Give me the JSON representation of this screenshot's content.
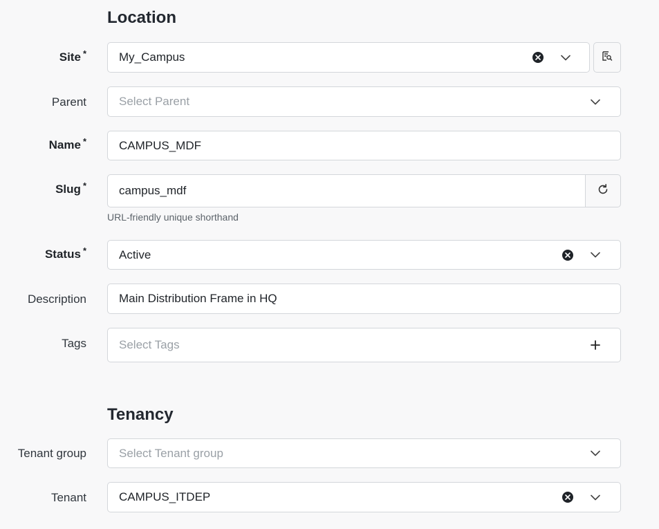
{
  "location": {
    "title": "Location",
    "site": {
      "label": "Site",
      "required_mark": "*",
      "value": "My_Campus"
    },
    "parent": {
      "label": "Parent",
      "placeholder": "Select Parent"
    },
    "name": {
      "label": "Name",
      "required_mark": "*",
      "value": "CAMPUS_MDF"
    },
    "slug": {
      "label": "Slug",
      "required_mark": "*",
      "value": "campus_mdf",
      "help": "URL-friendly unique shorthand"
    },
    "status": {
      "label": "Status",
      "required_mark": "*",
      "value": "Active"
    },
    "description": {
      "label": "Description",
      "value": "Main Distribution Frame in HQ"
    },
    "tags": {
      "label": "Tags",
      "placeholder": "Select Tags"
    }
  },
  "tenancy": {
    "title": "Tenancy",
    "tenant_group": {
      "label": "Tenant group",
      "placeholder": "Select Tenant group"
    },
    "tenant": {
      "label": "Tenant",
      "value": "CAMPUS_ITDEP"
    }
  },
  "icons": {
    "clear": "clear-circle-x-icon",
    "dropdown": "chevron-down-icon",
    "lookup": "search-selector-icon",
    "regenerate": "refresh-icon",
    "add": "plus-icon"
  }
}
